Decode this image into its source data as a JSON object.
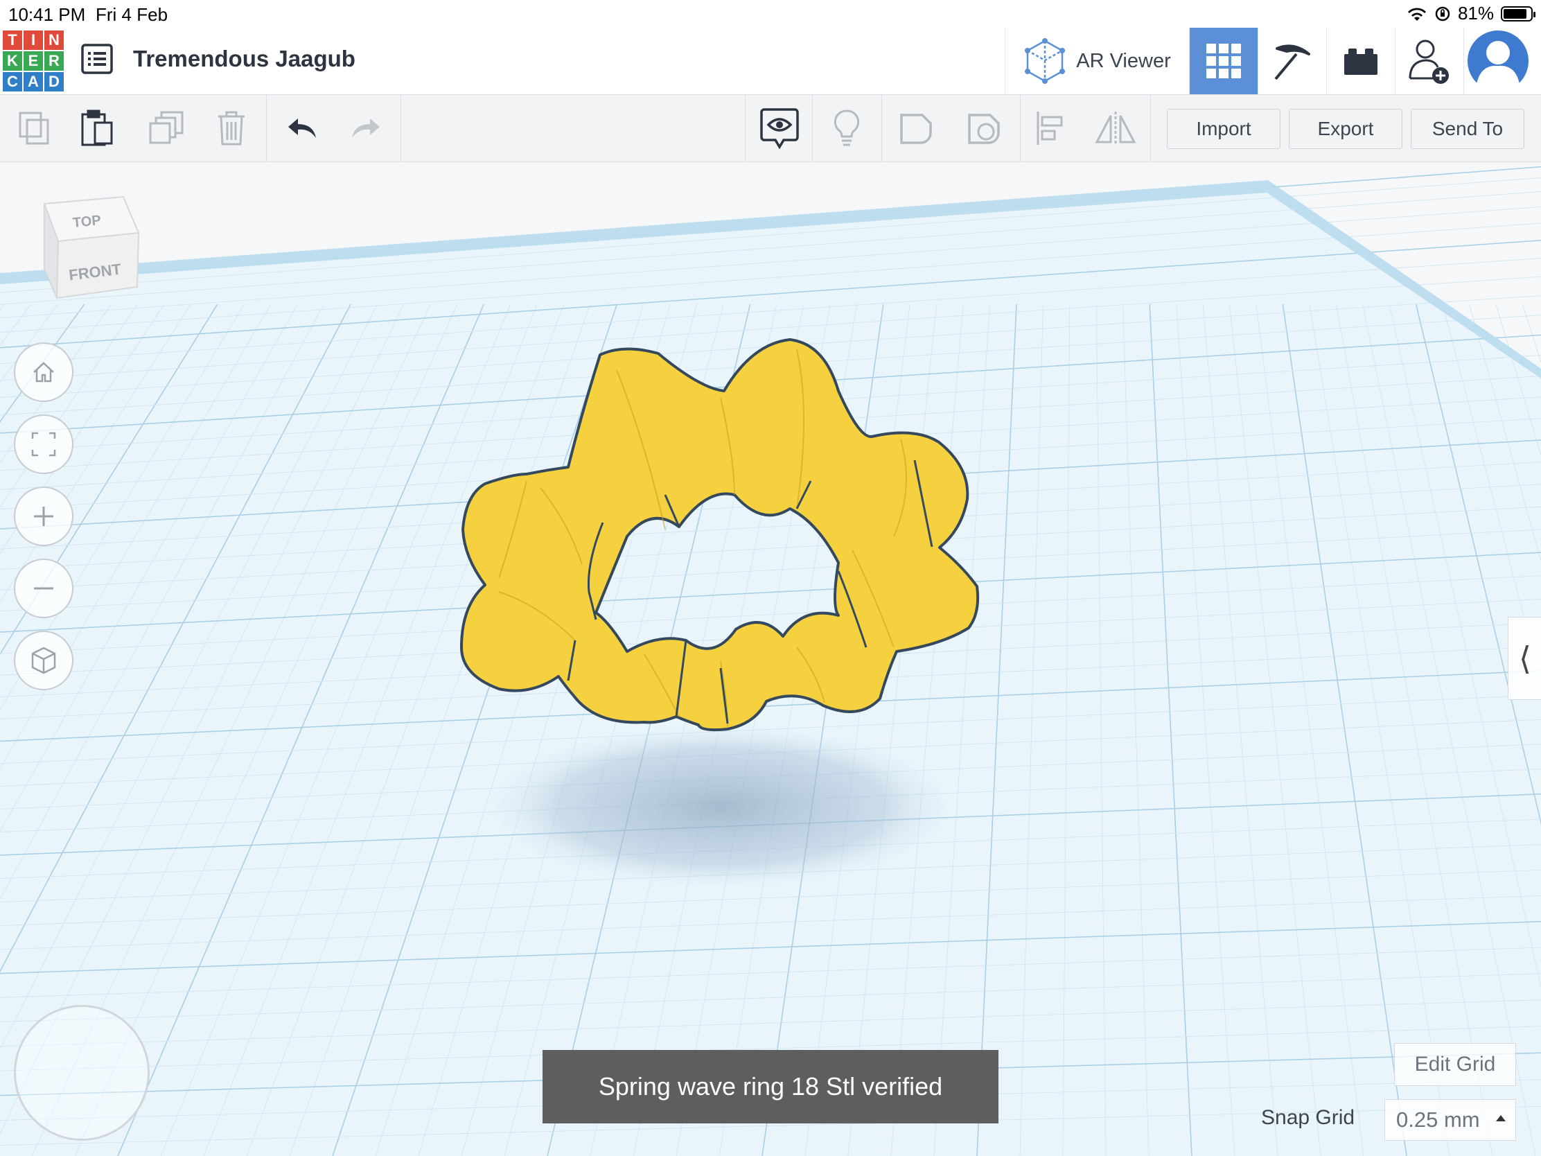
{
  "status": {
    "time": "10:41 PM",
    "date": "Fri 4 Feb",
    "battery": "81%"
  },
  "logo": {
    "letters": [
      "T",
      "I",
      "N",
      "K",
      "E",
      "R",
      "C",
      "A",
      "D"
    ],
    "colors": [
      "#e04a3b",
      "#e04a3b",
      "#e04a3b",
      "#39a853",
      "#39a853",
      "#39a853",
      "#2f7fc8",
      "#2f7fc8",
      "#2f7fc8"
    ]
  },
  "header": {
    "project_name": "Tremendous Jaagub",
    "ar_viewer": "AR Viewer",
    "accent": "#5b8fd6"
  },
  "toolbar": {
    "import": "Import",
    "export": "Export",
    "send_to": "Send To"
  },
  "viewcube": {
    "top": "TOP",
    "front": "FRONT"
  },
  "toast": {
    "message": "Spring wave ring 18 Stl verified"
  },
  "grid": {
    "edit": "Edit Grid",
    "snap_label": "Snap Grid",
    "snap_value": "0.25 mm"
  },
  "model": {
    "color": "#f5d03f",
    "outline": "#34495e"
  }
}
